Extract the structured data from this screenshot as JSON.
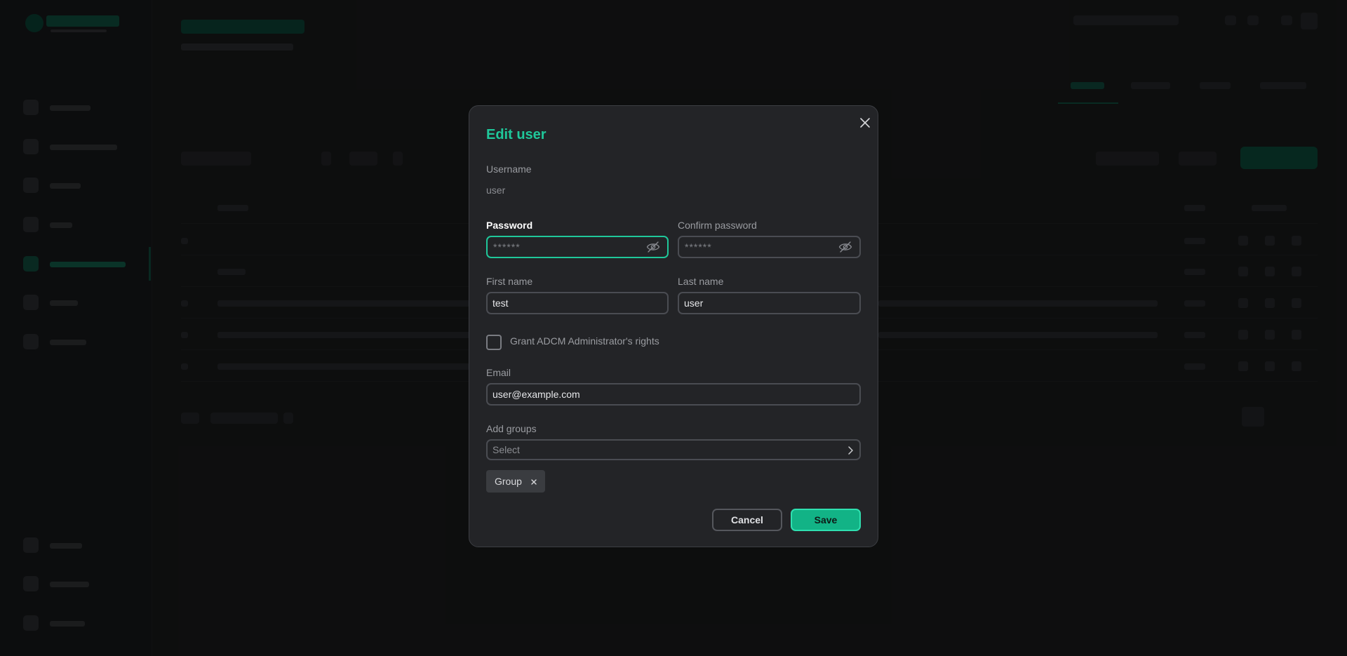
{
  "dialog": {
    "title": "Edit user",
    "username_label": "Username",
    "username_value": "user",
    "password_label": "Password",
    "password_mask": "******",
    "confirm_label": "Confirm password",
    "confirm_mask": "******",
    "first_name_label": "First name",
    "first_name_value": "test",
    "last_name_label": "Last name",
    "last_name_value": "user",
    "admin_rights_label": "Grant ADCM Administrator's rights",
    "admin_rights_checked": false,
    "email_label": "Email",
    "email_value": "user@example.com",
    "groups_label": "Add groups",
    "groups_placeholder": "Select",
    "selected_groups": [
      "Group"
    ],
    "cancel_label": "Cancel",
    "save_label": "Save"
  },
  "colors": {
    "accent": "#1fc79a",
    "save_button": "#12b386",
    "dialog_bg": "#232427",
    "overlay": "rgba(0,0,0,0.55)"
  },
  "icons": {
    "close": "close-icon",
    "password_toggle": "eye-off-icon",
    "select_open": "chevron-right-icon",
    "chip_remove": "close-small-icon"
  }
}
